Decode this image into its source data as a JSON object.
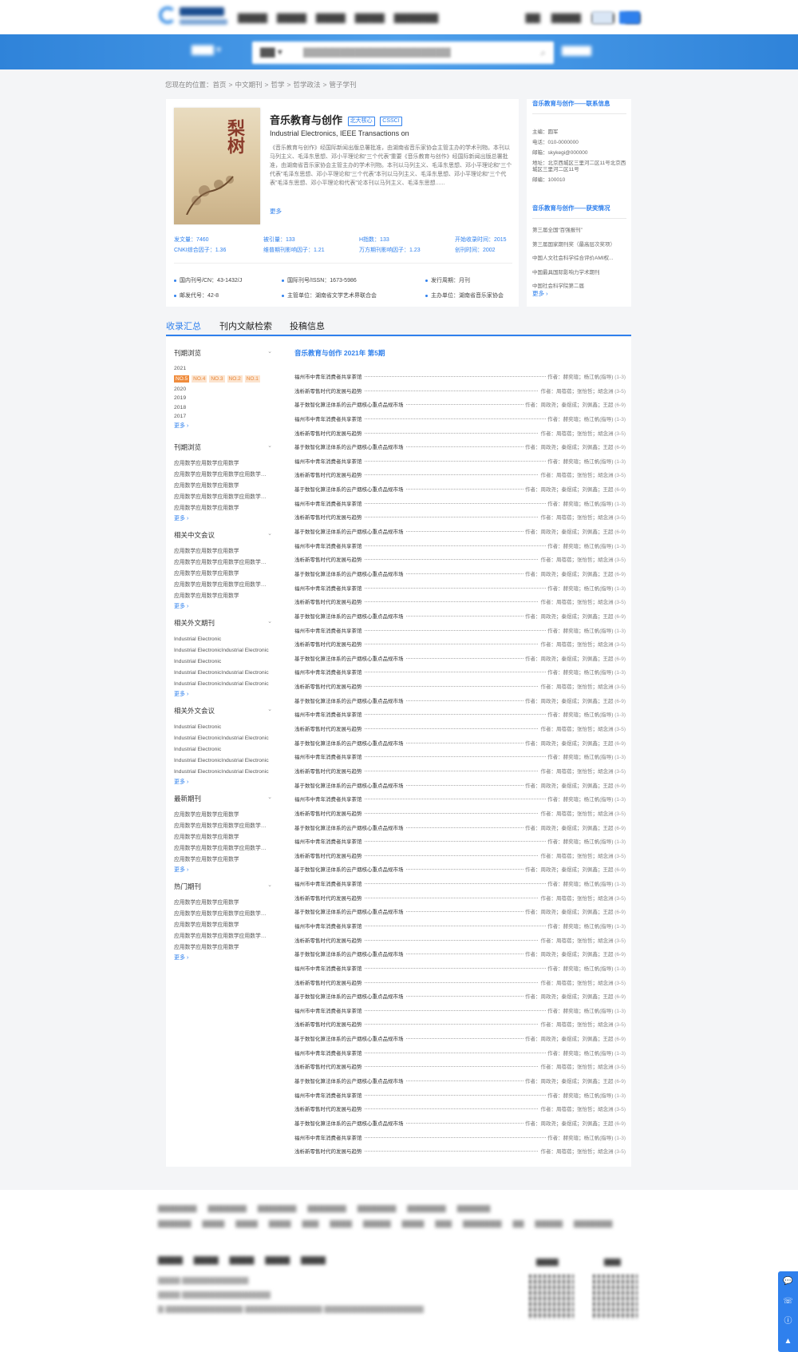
{
  "breadcrumbs": [
    "您现在的位置：首页",
    ">",
    "中文期刊",
    ">",
    "哲学",
    ">",
    "哲学政法",
    ">",
    "管子学刊"
  ],
  "journal": {
    "cover_title": "梨树",
    "title": "音乐教育与创作",
    "tags": [
      "北大核心",
      "CSSCI"
    ],
    "en_title": "Industrial Electronics, IEEE Transactions on",
    "description": "《音乐教育与创作》经国际新闻出版总署批准，由湖南省音乐家协会主管主办的学术刊物。本刊以马列主义、毛泽东思想、邓小平理论和“三个代表”重要《音乐教育与创作》经国际新闻出版总署批准，由湖南省音乐家协会主管主办的学术刊物。本刊以马列主义、毛泽东思想、邓小平理论和“三个代表”毛泽东思想、邓小平理论和“三个代表”本刊以马列主义、毛泽东思想、邓小平理论和“三个代表”毛泽东思想、邓小平理论和代表”论本刊以马列主义、毛泽东思想......",
    "more": "更多",
    "stats": [
      "发文量：7460",
      "被引量：133",
      "H指数：133",
      "开始收录时间：2015",
      "CNKI综合因子：1.36",
      "维普期刊影响因子：1.21",
      "万方期刊影响因子：1.23",
      "创刊时间：2002"
    ],
    "info": [
      "国内刊号/CN：43-1432/J",
      "国际刊号/ISSN：1673-5986",
      "发行周期：月刊",
      "邮发代号：42-8",
      "主管单位：湖南省文学艺术界联合会",
      "主办单位：湖南省音乐家协会"
    ]
  },
  "contact": {
    "heading": "音乐教育与创作——联系信息",
    "lines": [
      "主编：圆军",
      "电话：010-0000000",
      "邮箱：skykegi@000000",
      "地址：北京西城区三里河二区11号北京西城区三里河二区11号",
      "邮编：100010"
    ]
  },
  "awards": {
    "heading": "音乐教育与创作——获奖情况",
    "lines": [
      "第三届全国“百强报刊”",
      "第三届国家期刊奖（最高层次奖项）",
      "中国人文社会科学综合评价AMI权...",
      "中国最具国际影响力学术期刊",
      "中国社会科学院第二届"
    ],
    "more": "更多"
  },
  "tabs": [
    "收录汇总",
    "刊内文献检索",
    "投稿信息"
  ],
  "sidebar": {
    "groups": [
      {
        "title": "刊期浏览",
        "years": [
          "2021",
          "2020",
          "2019",
          "2018",
          "2017"
        ],
        "issues": [
          "NO.5",
          "NO.4",
          "NO.3",
          "NO.2",
          "NO.1"
        ],
        "more": "更多"
      },
      {
        "title": "刊期浏览",
        "items": [
          "应用数学应用数学应用数学",
          "应用数学应用数学应用数学应用数学应用数学",
          "应用数学应用数学应用数学",
          "应用数学应用数学应用数学应用数学应用数学",
          "应用数学应用数学应用数学"
        ],
        "more": "更多"
      },
      {
        "title": "相关中文会议",
        "items": [
          "应用数学应用数学应用数学",
          "应用数学应用数学应用数学应用数学应用数学",
          "应用数学应用数学应用数学",
          "应用数学应用数学应用数学应用数学应用数学",
          "应用数学应用数学应用数学"
        ],
        "more": "更多"
      },
      {
        "title": "相关外文期刊",
        "items": [
          "Industrial Electronic",
          "Industrial ElectronicIndustrial Electronic",
          "Industrial Electronic",
          "Industrial ElectronicIndustrial Electronic",
          "Industrial ElectronicIndustrial Electronic"
        ],
        "more": "更多"
      },
      {
        "title": "相关外文会议",
        "items": [
          "Industrial Electronic",
          "Industrial ElectronicIndustrial Electronic",
          "Industrial Electronic",
          "Industrial ElectronicIndustrial Electronic",
          "Industrial ElectronicIndustrial Electronic"
        ],
        "more": "更多"
      },
      {
        "title": "最新期刊",
        "items": [
          "应用数学应用数学应用数学",
          "应用数学应用数学应用数学应用数学应用数学",
          "应用数学应用数学应用数学",
          "应用数学应用数学应用数学应用数学应用数学",
          "应用数学应用数学应用数学"
        ],
        "more": "更多"
      },
      {
        "title": "热门期刊",
        "items": [
          "应用数学应用数学应用数学",
          "应用数学应用数学应用数学应用数学应用数学",
          "应用数学应用数学应用数学",
          "应用数学应用数学应用数学应用数学应用数学",
          "应用数学应用数学应用数学"
        ],
        "more": "更多"
      }
    ]
  },
  "main": {
    "issue_title": "音乐教育与创作  2021年 第5期",
    "article_templates": [
      {
        "title": "福州市中青年消费者共享茶馆",
        "authors": "作者：赫奕瑄；杨江帆(指导)",
        "pages": "(1-3)"
      },
      {
        "title": "浅析新零售时代的发展与趋势",
        "authors": "作者：周蓓蓓；张怡哲；胡念洲",
        "pages": "(3-5)"
      },
      {
        "title": "基于数智化算法体系的云产烟核心重点品规市场",
        "authors": "作者：周政尧；秦煜成；刘佩鑫；王超",
        "pages": "(6-9)"
      }
    ],
    "row_count": 56
  },
  "colors": {
    "accent": "#2f80ed",
    "issue_current": "#f08c3c",
    "issue_other": "#fce4cf"
  }
}
